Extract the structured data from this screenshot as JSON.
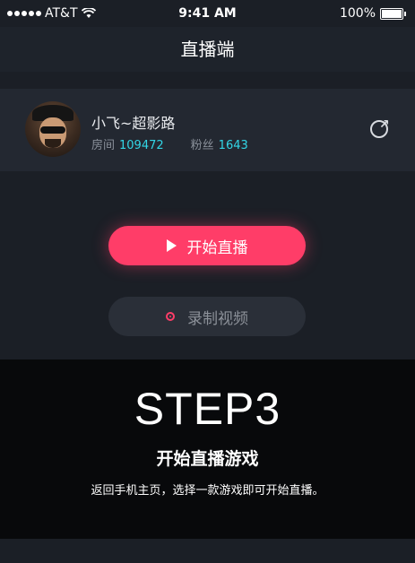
{
  "status_bar": {
    "carrier": "AT&T",
    "time": "9:41 AM",
    "battery": "100%",
    "icons": [
      "signal-dots-icon",
      "wifi-icon",
      "battery-icon"
    ]
  },
  "nav": {
    "title": "直播端"
  },
  "user": {
    "name": "小飞~超影路",
    "room_label": "房间",
    "room_value": "109472",
    "fans_label": "粉丝",
    "fans_value": "1643",
    "avatar_icon": "user-avatar",
    "action_icon": "share-icon"
  },
  "actions": {
    "start_live_label": "开始直播",
    "record_label": "录制视频"
  },
  "step": {
    "title": "STEP3",
    "subtitle": "开始直播游戏",
    "description": "返回手机主页，选择一款游戏即可开始直播。"
  },
  "colors": {
    "accent": "#ff3d68",
    "highlight": "#32d6e6",
    "background": "#1b1f26"
  }
}
